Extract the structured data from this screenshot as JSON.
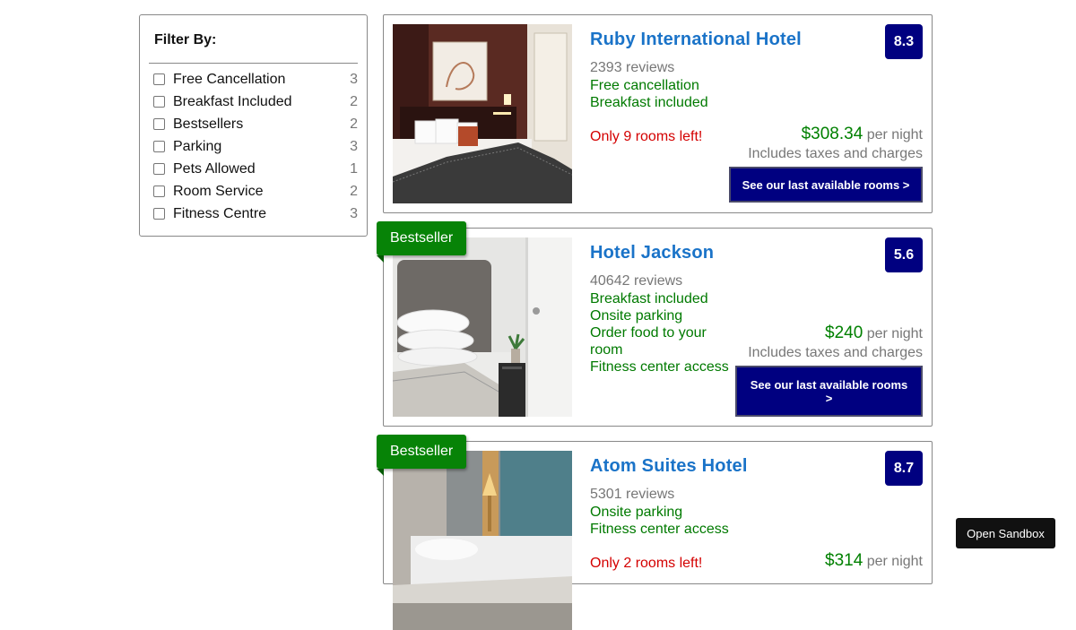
{
  "filters": {
    "title": "Filter By:",
    "items": [
      {
        "label": "Free Cancellation",
        "count": "3"
      },
      {
        "label": "Breakfast Included",
        "count": "2"
      },
      {
        "label": "Bestsellers",
        "count": "2"
      },
      {
        "label": "Parking",
        "count": "3"
      },
      {
        "label": "Pets Allowed",
        "count": "1"
      },
      {
        "label": "Room Service",
        "count": "2"
      },
      {
        "label": "Fitness Centre",
        "count": "3"
      }
    ]
  },
  "hotels": [
    {
      "name": "Ruby International Hotel",
      "rating": "8.3",
      "reviews": "2393 reviews",
      "features": [
        "Free cancellation",
        "Breakfast included"
      ],
      "scarcity": "Only 9 rooms left!",
      "price": "$308.34",
      "per_night": "per night",
      "taxes": "Includes taxes and charges",
      "cta": "See our last available rooms >"
    },
    {
      "badge": "Bestseller",
      "name": "Hotel Jackson",
      "rating": "5.6",
      "reviews": "40642 reviews",
      "features": [
        "Breakfast included",
        "Onsite parking",
        "Order food to your room",
        "Fitness center access"
      ],
      "price": "$240",
      "per_night": "per night",
      "taxes": "Includes taxes and charges",
      "cta": "See our last available rooms >"
    },
    {
      "badge": "Bestseller",
      "name": "Atom Suites Hotel",
      "rating": "8.7",
      "reviews": "5301 reviews",
      "features": [
        "Onsite parking",
        "Fitness center access"
      ],
      "scarcity": "Only 2 rooms left!",
      "price": "$314",
      "per_night": "per night"
    }
  ],
  "sandbox_button": "Open Sandbox",
  "colors": {
    "accent_navy": "#000080",
    "hotel_name_blue": "#1a73c8",
    "feature_green": "#007a00",
    "badge_green": "#078307",
    "scarcity_red": "#d40000"
  }
}
